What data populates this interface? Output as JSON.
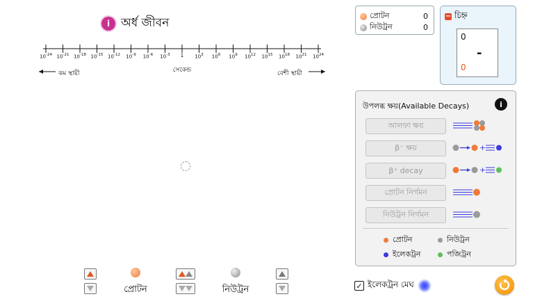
{
  "half_life": {
    "info_badge": "i",
    "title": "অর্ধ জীবন",
    "ticks": [
      {
        "base": "10",
        "exp": "-24"
      },
      {
        "base": "10",
        "exp": "-21"
      },
      {
        "base": "10",
        "exp": "-18"
      },
      {
        "base": "10",
        "exp": "-15"
      },
      {
        "base": "10",
        "exp": "-12"
      },
      {
        "base": "10",
        "exp": "-9"
      },
      {
        "base": "10",
        "exp": "-6"
      },
      {
        "base": "10",
        "exp": "-3"
      },
      {
        "base": "1",
        "exp": ""
      },
      {
        "base": "10",
        "exp": "3"
      },
      {
        "base": "10",
        "exp": "6"
      },
      {
        "base": "10",
        "exp": "9"
      },
      {
        "base": "10",
        "exp": "12"
      },
      {
        "base": "10",
        "exp": "15"
      },
      {
        "base": "10",
        "exp": "18"
      },
      {
        "base": "10",
        "exp": "21"
      },
      {
        "base": "10",
        "exp": "24"
      }
    ],
    "unit": "সেকেন্ড",
    "less_stable": "কম স্থায়ী",
    "more_stable": "বেশী স্থায়ী"
  },
  "counts": {
    "proton_label": "প্রোটন",
    "proton_value": "0",
    "neutron_label": "নিউট্রন",
    "neutron_value": "0"
  },
  "charge": {
    "title": "চিহ্ন",
    "top_value": "0",
    "sign": "-",
    "bottom_value": "0"
  },
  "decays": {
    "title": "উপলব্ধ ক্ষয়(Available Decays)",
    "info_badge": "i",
    "buttons": [
      {
        "label": "আলফা ক্ষয়",
        "icon": "alpha-icon"
      },
      {
        "label": "β⁻ ক্ষয়",
        "icon": "beta-minus-icon"
      },
      {
        "label": "β⁺ decay",
        "icon": "beta-plus-icon"
      },
      {
        "label": "প্রোটন নির্গমন",
        "icon": "proton-emission-icon"
      },
      {
        "label": "নিউট্রন নির্গমন",
        "icon": "neutron-emission-icon"
      }
    ],
    "legend": {
      "proton": "প্রোটন",
      "neutron": "নিউট্রন",
      "electron": "ইলেকট্রন",
      "positron": "পজিট্রন"
    }
  },
  "controls": {
    "proton_label": "প্রোটন",
    "neutron_label": "নিউট্রন"
  },
  "electron_cloud": {
    "label": "ইলেকট্রন মেঘ",
    "checked": true
  },
  "colors": {
    "proton": "#f07a3a",
    "neutron": "#9a9a9a",
    "electron": "#3a3adf",
    "positron": "#5cc05c",
    "accent": "#c9308f",
    "reset": "#f5a000"
  }
}
